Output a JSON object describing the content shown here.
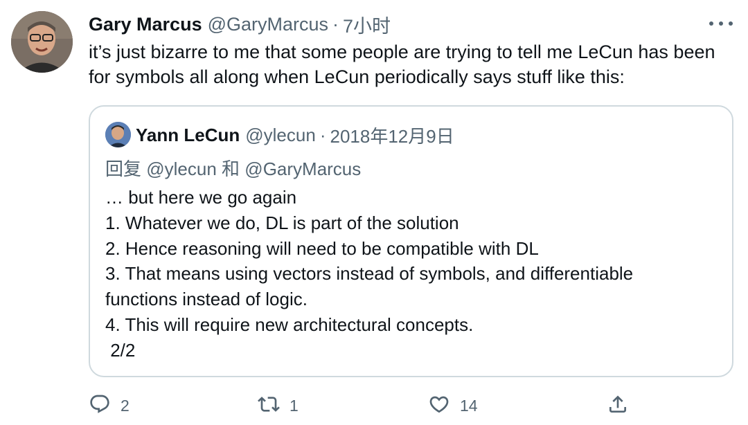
{
  "tweet": {
    "author": {
      "name": "Gary Marcus",
      "handle": "@GaryMarcus"
    },
    "separator": "·",
    "time": "7小时",
    "text": "it’s just bizarre to me that some people are trying to tell me LeCun has been for symbols all along when LeCun periodically says stuff like this:",
    "more_icon": "more-horizontal-icon"
  },
  "quote": {
    "author": {
      "name": "Yann LeCun",
      "handle": "@ylecun"
    },
    "separator": "·",
    "date": "2018年12月9日",
    "reply": {
      "prefix": "回复",
      "mention1": "@ylecun",
      "conj": "和",
      "mention2": "@GaryMarcus"
    },
    "lines": [
      "… but here we go again",
      "1. Whatever we do, DL is part of the solution",
      "2. Hence reasoning will need to be compatible with DL",
      "3. That means using vectors instead of symbols, and differentiable",
      "functions instead of logic.",
      "4. This will require new architectural concepts.",
      " 2/2"
    ]
  },
  "actions": {
    "reply": {
      "icon": "reply-icon",
      "count": "2"
    },
    "retweet": {
      "icon": "retweet-icon",
      "count": "1"
    },
    "like": {
      "icon": "heart-icon",
      "count": "14"
    },
    "share": {
      "icon": "share-icon"
    }
  },
  "colors": {
    "text": "#0f1419",
    "secondary": "#536471",
    "border": "#cfd9de"
  }
}
